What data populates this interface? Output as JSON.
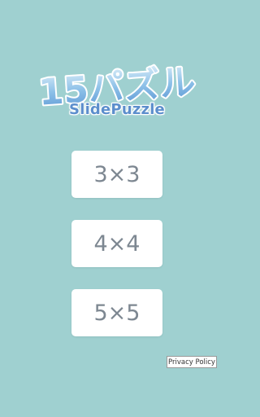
{
  "app": {
    "title_number": "15",
    "title_kana": "パズル",
    "subtitle": "SlidePuzzle"
  },
  "menu": {
    "sizes": [
      {
        "label": "3×3"
      },
      {
        "label": "4×4"
      },
      {
        "label": "5×5"
      }
    ]
  },
  "footer": {
    "privacy_label": "Privacy Policy"
  },
  "colors": {
    "background": "#9fd0d0",
    "button_bg": "#ffffff",
    "button_text": "#7d8791",
    "logo_blue": "#6fa9dc",
    "logo_outline": "#ffffff"
  }
}
